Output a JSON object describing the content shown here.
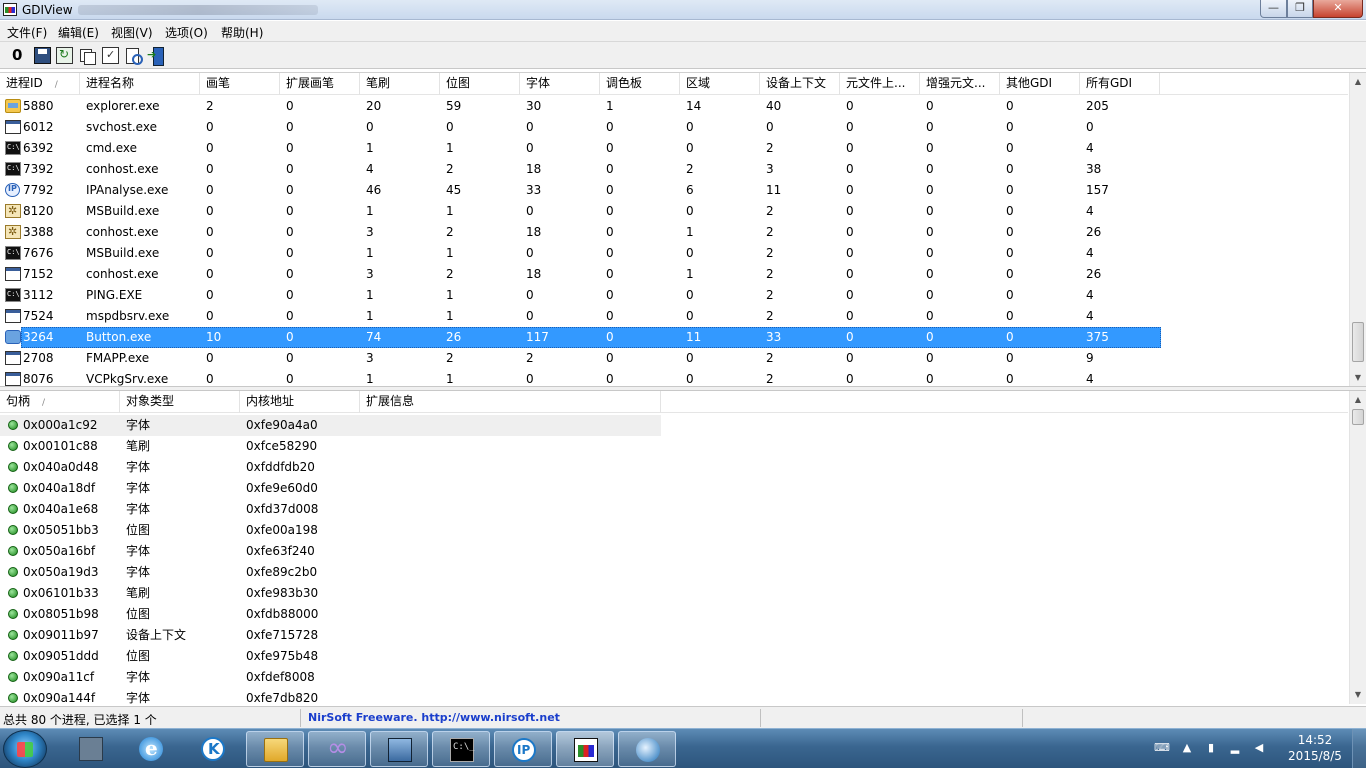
{
  "window": {
    "title": "GDIView",
    "minimize_label": "—",
    "maximize_label": "❐",
    "close_label": "✕"
  },
  "menu": [
    "文件(F)",
    "编辑(E)",
    "视图(V)",
    "选项(O)",
    "帮助(H)"
  ],
  "toolbar": {
    "zero_label": "0",
    "icons": [
      "save-icon",
      "refresh-icon",
      "copy-icon",
      "properties-icon",
      "find-icon",
      "exit-icon"
    ]
  },
  "process_table": {
    "sort_column": "进程ID",
    "columns": [
      "进程ID",
      "进程名称",
      "画笔",
      "扩展画笔",
      "笔刷",
      "位图",
      "字体",
      "调色板",
      "区域",
      "设备上下文",
      "元文件上...",
      "增强元文...",
      "其他GDI",
      "所有GDI"
    ],
    "selected_index": 11,
    "rows": [
      {
        "icon": "explorer-icon",
        "pid": "5880",
        "name": "explorer.exe",
        "v": [
          "2",
          "0",
          "20",
          "59",
          "30",
          "1",
          "14",
          "40",
          "0",
          "0",
          "0",
          "205"
        ]
      },
      {
        "icon": "window-icon",
        "pid": "6012",
        "name": "svchost.exe",
        "v": [
          "0",
          "0",
          "0",
          "0",
          "0",
          "0",
          "0",
          "0",
          "0",
          "0",
          "0",
          "0"
        ]
      },
      {
        "icon": "console-icon",
        "pid": "6392",
        "name": "cmd.exe",
        "v": [
          "0",
          "0",
          "1",
          "1",
          "0",
          "0",
          "0",
          "2",
          "0",
          "0",
          "0",
          "4"
        ]
      },
      {
        "icon": "console-icon",
        "pid": "7392",
        "name": "conhost.exe",
        "v": [
          "0",
          "0",
          "4",
          "2",
          "18",
          "0",
          "2",
          "3",
          "0",
          "0",
          "0",
          "38"
        ]
      },
      {
        "icon": "ip-icon",
        "pid": "7792",
        "name": "IPAnalyse.exe",
        "v": [
          "0",
          "0",
          "46",
          "45",
          "33",
          "0",
          "6",
          "11",
          "0",
          "0",
          "0",
          "157"
        ]
      },
      {
        "icon": "gear-icon",
        "pid": "8120",
        "name": "MSBuild.exe",
        "v": [
          "0",
          "0",
          "1",
          "1",
          "0",
          "0",
          "0",
          "2",
          "0",
          "0",
          "0",
          "4"
        ]
      },
      {
        "icon": "gear-icon",
        "pid": "3388",
        "name": "conhost.exe",
        "v": [
          "0",
          "0",
          "3",
          "2",
          "18",
          "0",
          "1",
          "2",
          "0",
          "0",
          "0",
          "26"
        ]
      },
      {
        "icon": "console-icon",
        "pid": "7676",
        "name": "MSBuild.exe",
        "v": [
          "0",
          "0",
          "1",
          "1",
          "0",
          "0",
          "0",
          "2",
          "0",
          "0",
          "0",
          "4"
        ]
      },
      {
        "icon": "window-icon",
        "pid": "7152",
        "name": "conhost.exe",
        "v": [
          "0",
          "0",
          "3",
          "2",
          "18",
          "0",
          "1",
          "2",
          "0",
          "0",
          "0",
          "26"
        ]
      },
      {
        "icon": "console-icon",
        "pid": "3112",
        "name": "PING.EXE",
        "v": [
          "0",
          "0",
          "1",
          "1",
          "0",
          "0",
          "0",
          "2",
          "0",
          "0",
          "0",
          "4"
        ]
      },
      {
        "icon": "window-icon",
        "pid": "7524",
        "name": "mspdbsrv.exe",
        "v": [
          "0",
          "0",
          "1",
          "1",
          "0",
          "0",
          "0",
          "2",
          "0",
          "0",
          "0",
          "4"
        ]
      },
      {
        "icon": "button-app-icon",
        "pid": "3264",
        "name": "Button.exe",
        "v": [
          "10",
          "0",
          "74",
          "26",
          "117",
          "0",
          "11",
          "33",
          "0",
          "0",
          "0",
          "375"
        ]
      },
      {
        "icon": "window-icon",
        "pid": "2708",
        "name": "FMAPP.exe",
        "v": [
          "0",
          "0",
          "3",
          "2",
          "2",
          "0",
          "0",
          "2",
          "0",
          "0",
          "0",
          "9"
        ]
      },
      {
        "icon": "window-icon",
        "pid": "8076",
        "name": "VCPkgSrv.exe",
        "v": [
          "0",
          "0",
          "1",
          "1",
          "0",
          "0",
          "0",
          "2",
          "0",
          "0",
          "0",
          "4"
        ]
      }
    ]
  },
  "handle_table": {
    "sort_column": "句柄",
    "columns": [
      "句柄",
      "对象类型",
      "内核地址",
      "扩展信息"
    ],
    "rows": [
      {
        "handle": "0x000a1c92",
        "type": "字体",
        "addr": "0xfe90a4a0"
      },
      {
        "handle": "0x00101c88",
        "type": "笔刷",
        "addr": "0xfce58290"
      },
      {
        "handle": "0x040a0d48",
        "type": "字体",
        "addr": "0xfddfdb20"
      },
      {
        "handle": "0x040a18df",
        "type": "字体",
        "addr": "0xfe9e60d0"
      },
      {
        "handle": "0x040a1e68",
        "type": "字体",
        "addr": "0xfd37d008"
      },
      {
        "handle": "0x05051bb3",
        "type": "位图",
        "addr": "0xfe00a198"
      },
      {
        "handle": "0x050a16bf",
        "type": "字体",
        "addr": "0xfe63f240"
      },
      {
        "handle": "0x050a19d3",
        "type": "字体",
        "addr": "0xfe89c2b0"
      },
      {
        "handle": "0x06101b33",
        "type": "笔刷",
        "addr": "0xfe983b30"
      },
      {
        "handle": "0x08051b98",
        "type": "位图",
        "addr": "0xfdb88000"
      },
      {
        "handle": "0x09011b97",
        "type": "设备上下文",
        "addr": "0xfe715728"
      },
      {
        "handle": "0x09051ddd",
        "type": "位图",
        "addr": "0xfe975b48"
      },
      {
        "handle": "0x090a11cf",
        "type": "字体",
        "addr": "0xfdef8008"
      },
      {
        "handle": "0x090a144f",
        "type": "字体",
        "addr": "0xfe7db820"
      }
    ]
  },
  "status": {
    "summary": "总共 80 个进程, 已选择 1 个",
    "credit": "NirSoft Freeware.  http://www.nirsoft.net"
  },
  "taskbar": {
    "buttons": [
      "network-app-icon",
      "ie-icon",
      "k-app-icon",
      "folder-icon",
      "visual-studio-icon",
      "image-viewer-icon",
      "cmd-icon",
      "ipanalyse-icon",
      "gdiview-icon",
      "shell-app-icon"
    ],
    "active_index": 8,
    "tray_icons": [
      "keyboard-icon",
      "show-hidden-icon",
      "battery-icon",
      "signal-icon",
      "volume-icon"
    ],
    "time": "14:52",
    "date": "2015/8/5"
  }
}
